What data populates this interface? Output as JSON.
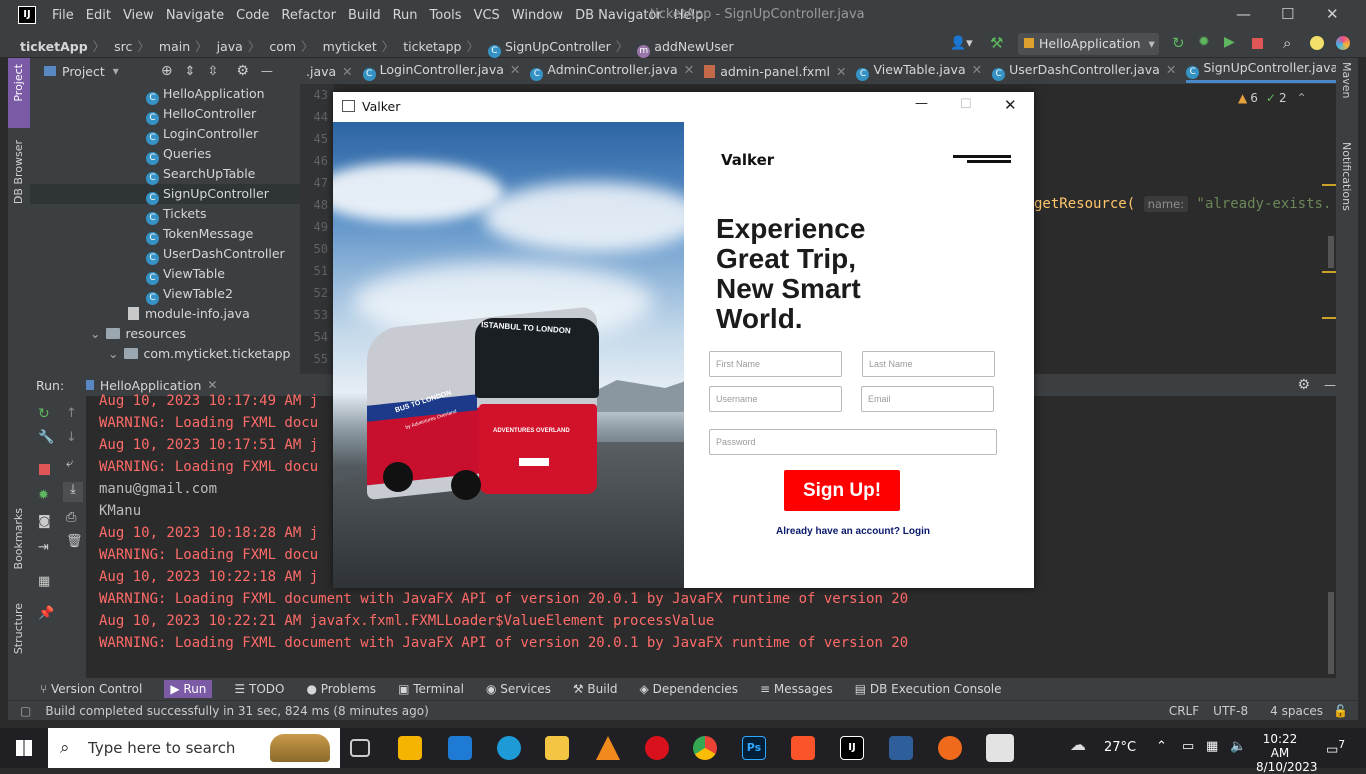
{
  "window": {
    "title": "ticketApp - SignUpController.java"
  },
  "menu": [
    "File",
    "Edit",
    "View",
    "Navigate",
    "Code",
    "Refactor",
    "Build",
    "Run",
    "Tools",
    "VCS",
    "Window",
    "DB Navigator",
    "Help"
  ],
  "breadcrumbs": [
    "ticketApp",
    "src",
    "main",
    "java",
    "com",
    "myticket",
    "ticketapp",
    "SignUpController",
    "addNewUser"
  ],
  "run_config": "HelloApplication",
  "project_panel": {
    "title": "Project"
  },
  "tree": [
    {
      "label": "HelloApplication",
      "type": "class"
    },
    {
      "label": "HelloController",
      "type": "class"
    },
    {
      "label": "LoginController",
      "type": "class"
    },
    {
      "label": "Queries",
      "type": "class"
    },
    {
      "label": "SearchUpTable",
      "type": "class"
    },
    {
      "label": "SignUpController",
      "type": "class",
      "selected": true
    },
    {
      "label": "Tickets",
      "type": "class"
    },
    {
      "label": "TokenMessage",
      "type": "class"
    },
    {
      "label": "UserDashController",
      "type": "class"
    },
    {
      "label": "ViewTable",
      "type": "class"
    },
    {
      "label": "ViewTable2",
      "type": "class"
    },
    {
      "label": "module-info.java",
      "type": "file"
    },
    {
      "label": "resources",
      "type": "folder"
    },
    {
      "label": "com.myticket.ticketapp",
      "type": "folder"
    }
  ],
  "tabs": [
    ".java",
    "LoginController.java",
    "AdminController.java",
    "admin-panel.fxml",
    "ViewTable.java",
    "UserDashController.java",
    "SignUpController.java"
  ],
  "line_numbers": [
    "43",
    "44",
    "45",
    "46",
    "47",
    "48",
    "49",
    "50",
    "51",
    "52",
    "53",
    "54",
    "55"
  ],
  "editor": {
    "code_method": "getResource(",
    "code_hint": "name:",
    "code_string": "\"already-exists."
  },
  "inspections": {
    "warnings": "6",
    "checks": "2"
  },
  "run_panel": {
    "label": "Run:",
    "tab": "HelloApplication"
  },
  "console": [
    {
      "text": "Aug 10, 2023 10:17:49 AM j",
      "kind": "red"
    },
    {
      "text": "WARNING: Loading FXML docu",
      "kind": "red"
    },
    {
      "text": "Aug 10, 2023 10:17:51 AM j",
      "kind": "red"
    },
    {
      "text": "WARNING: Loading FXML docu",
      "kind": "red"
    },
    {
      "text": "manu@gmail.com",
      "kind": "plain"
    },
    {
      "text": "KManu",
      "kind": "plain"
    },
    {
      "text": "Aug 10, 2023 10:18:28 AM j",
      "kind": "red"
    },
    {
      "text": "WARNING: Loading FXML docu",
      "kind": "red"
    },
    {
      "text": "Aug 10, 2023 10:22:18 AM j",
      "kind": "red"
    },
    {
      "text": "WARNING: Loading FXML document with JavaFX API of version 20.0.1 by JavaFX runtime of version 20",
      "kind": "red"
    },
    {
      "text": "Aug 10, 2023 10:22:21 AM javafx.fxml.FXMLLoader$ValueElement processValue",
      "kind": "red"
    },
    {
      "text": "WARNING: Loading FXML document with JavaFX API of version 20.0.1 by JavaFX runtime of version 20",
      "kind": "red"
    }
  ],
  "bottom_tabs": [
    "Version Control",
    "Run",
    "TODO",
    "Problems",
    "Terminal",
    "Services",
    "Build",
    "Dependencies",
    "Messages",
    "DB Execution Console"
  ],
  "status": {
    "message": "Build completed successfully in 31 sec, 824 ms (8 minutes ago)",
    "line_sep": "CRLF",
    "encoding": "UTF-8",
    "indent": "4 spaces"
  },
  "side_labels": {
    "project": "Project",
    "db_browser": "DB Browser",
    "bookmarks": "Bookmarks",
    "structure": "Structure",
    "maven": "Maven",
    "notifications": "Notifications"
  },
  "fx": {
    "title": "Valker",
    "brand": "Valker",
    "headline": "Experience Great Trip, New Smart World.",
    "first_name": "First Name",
    "last_name": "Last Name",
    "username": "Username",
    "email": "Email",
    "password": "Password",
    "signup": "Sign Up!",
    "login_link": "Already have an account? Login",
    "bus_top": "ISTANBUL TO LONDON",
    "bus_side": "BUS TO LONDON",
    "bus_side_small": "by Adventures Overland",
    "bus_front": "ADVENTURES OVERLAND"
  },
  "taskbar": {
    "search_placeholder": "Type here to search",
    "temperature": "27°C",
    "time": "10:22 AM",
    "date": "8/10/2023",
    "notifications": "7"
  },
  "colors": {
    "accent_red": "#fe0000",
    "ide_bg": "#2b2b2b",
    "panel_bg": "#3c3f41",
    "console_red": "#ff6b68"
  }
}
